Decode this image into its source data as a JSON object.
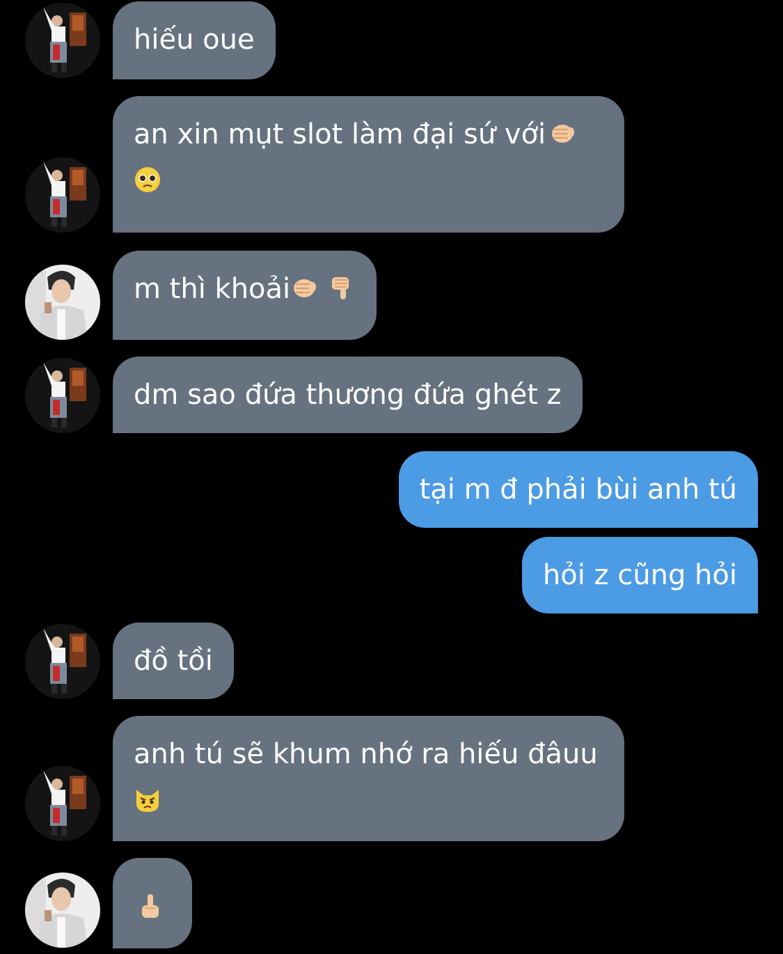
{
  "messages": [
    {
      "side": "in",
      "avatar": "avatar-a",
      "line1": "hiếu oue"
    },
    {
      "side": "in",
      "avatar": "avatar-a",
      "line1": "an xin mụt slot làm đại sứ với",
      "emoji1": "fist-bump-emoji",
      "emoji2": "pleading-face-emoji"
    },
    {
      "side": "in",
      "avatar": "avatar-b",
      "line1": "m thì khoải",
      "emoji1": "fist-bump-emoji",
      "emoji1b": "thumbs-down-emoji"
    },
    {
      "side": "in",
      "avatar": "avatar-a",
      "line1": "dm sao đứa thương đứa ghét z"
    },
    {
      "side": "out",
      "line1": "tại m đ phải bùi anh tú"
    },
    {
      "side": "out",
      "line1": "hỏi z cũng hỏi"
    },
    {
      "side": "in",
      "avatar": "avatar-a",
      "line1": "đồ tồi"
    },
    {
      "side": "in",
      "avatar": "avatar-a",
      "line1": "anh tú sẽ khum nhớ ra hiếu đâuu",
      "emoji2": "pouting-cat-emoji"
    },
    {
      "side": "in",
      "avatar": "avatar-b",
      "emoji2": "middle-finger-emoji"
    }
  ],
  "colors": {
    "background": "#000000",
    "incoming_bubble": "#66727f",
    "outgoing_bubble": "#4c9be5",
    "text": "#ffffff"
  }
}
